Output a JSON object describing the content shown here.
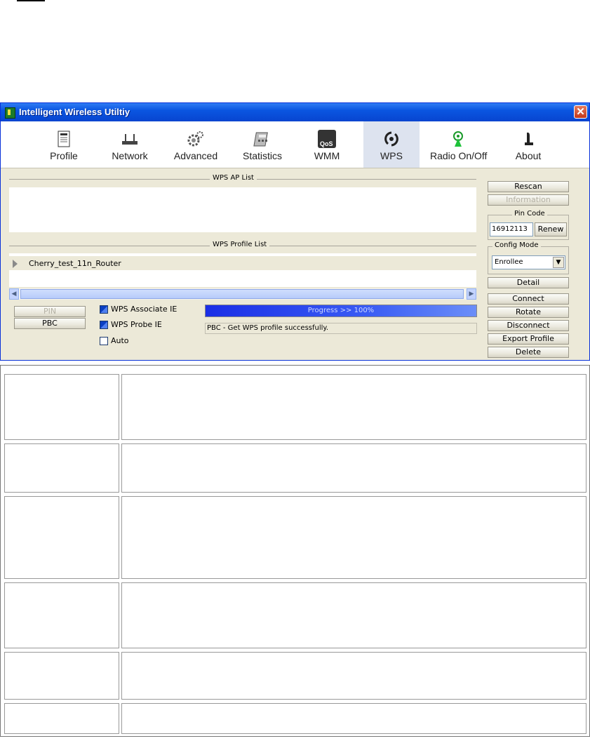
{
  "window": {
    "title": "Intelligent Wireless Utiltiy",
    "close_glyph": "✕"
  },
  "toolbar": {
    "items": [
      {
        "label": "Profile",
        "icon": "profile-icon"
      },
      {
        "label": "Network",
        "icon": "network-icon"
      },
      {
        "label": "Advanced",
        "icon": "advanced-icon"
      },
      {
        "label": "Statistics",
        "icon": "statistics-icon"
      },
      {
        "label": "WMM",
        "icon": "wmm-icon",
        "icon_text": "QoS"
      },
      {
        "label": "WPS",
        "icon": "wps-icon",
        "active": true
      },
      {
        "label": "Radio On/Off",
        "icon": "radio-icon"
      },
      {
        "label": "About",
        "icon": "about-icon"
      }
    ]
  },
  "wps": {
    "ap_list_title": "WPS AP List",
    "profile_list_title": "WPS Profile List",
    "profile_items": [
      "Cherry_test_11n_Router"
    ],
    "pin_button": "PIN",
    "pbc_button": "PBC",
    "checkboxes": [
      {
        "label": "WPS Associate IE",
        "checked": true
      },
      {
        "label": "WPS Probe IE",
        "checked": true
      },
      {
        "label": "Auto",
        "checked": false
      }
    ],
    "progress_text": "Progress >> 100%",
    "progress_value": 100,
    "status_text": "PBC - Get WPS profile successfully."
  },
  "side": {
    "rescan": "Rescan",
    "information": "Information",
    "pin_code_title": "Pin Code",
    "pin_code_value": "16912113",
    "renew": "Renew",
    "config_mode_title": "Config Mode",
    "config_mode_value": "Enrollee",
    "detail": "Detail",
    "connect": "Connect",
    "rotate": "Rotate",
    "disconnect": "Disconnect",
    "export_profile": "Export Profile",
    "delete": "Delete"
  },
  "colors": {
    "titlebar": "#0a55e0",
    "window_bg": "#ece9d8",
    "progress": "#2244ee"
  }
}
